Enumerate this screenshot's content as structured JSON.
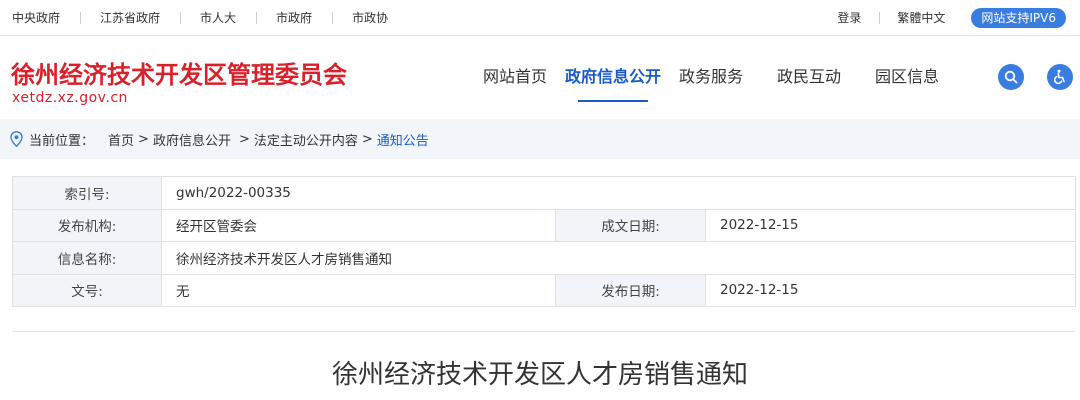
{
  "topbar": {
    "links": [
      "中央政府",
      "江苏省政府",
      "市人大",
      "市政府",
      "市政协"
    ],
    "login": "登录",
    "traditional": "繁體中文",
    "ipv6": "网站支持IPV6"
  },
  "header": {
    "title": "徐州经济技术开发区管理委员会",
    "domain": "xetdz.xz.gov.cn",
    "nav": [
      "网站首页",
      "政府信息公开",
      "政务服务",
      "政民互动",
      "园区信息"
    ],
    "search_icon": "search-icon",
    "accessibility_icon": "wheelchair-icon"
  },
  "breadcrumb": {
    "label": "当前位置：",
    "items": [
      "首页",
      "政府信息公开",
      "法定主动公开内容"
    ],
    "current": "通知公告"
  },
  "meta": {
    "index_label": "索引号:",
    "index_value": "gwh/2022-00335",
    "org_label": "发布机构:",
    "org_value": "经开区管委会",
    "date_written_label": "成文日期:",
    "date_written_value": "2022-12-15",
    "name_label": "信息名称:",
    "name_value": "徐州经济技术开发区人才房销售通知",
    "doc_label": "文号:",
    "doc_value": "无",
    "pub_label": "发布日期:",
    "pub_value": "2022-12-15"
  },
  "article": {
    "title": "徐州经济技术开发区人才房销售通知"
  },
  "colors": {
    "brand_red": "#d8222b",
    "accent_blue": "#1a5bc8",
    "button_blue": "#3a7de0"
  }
}
